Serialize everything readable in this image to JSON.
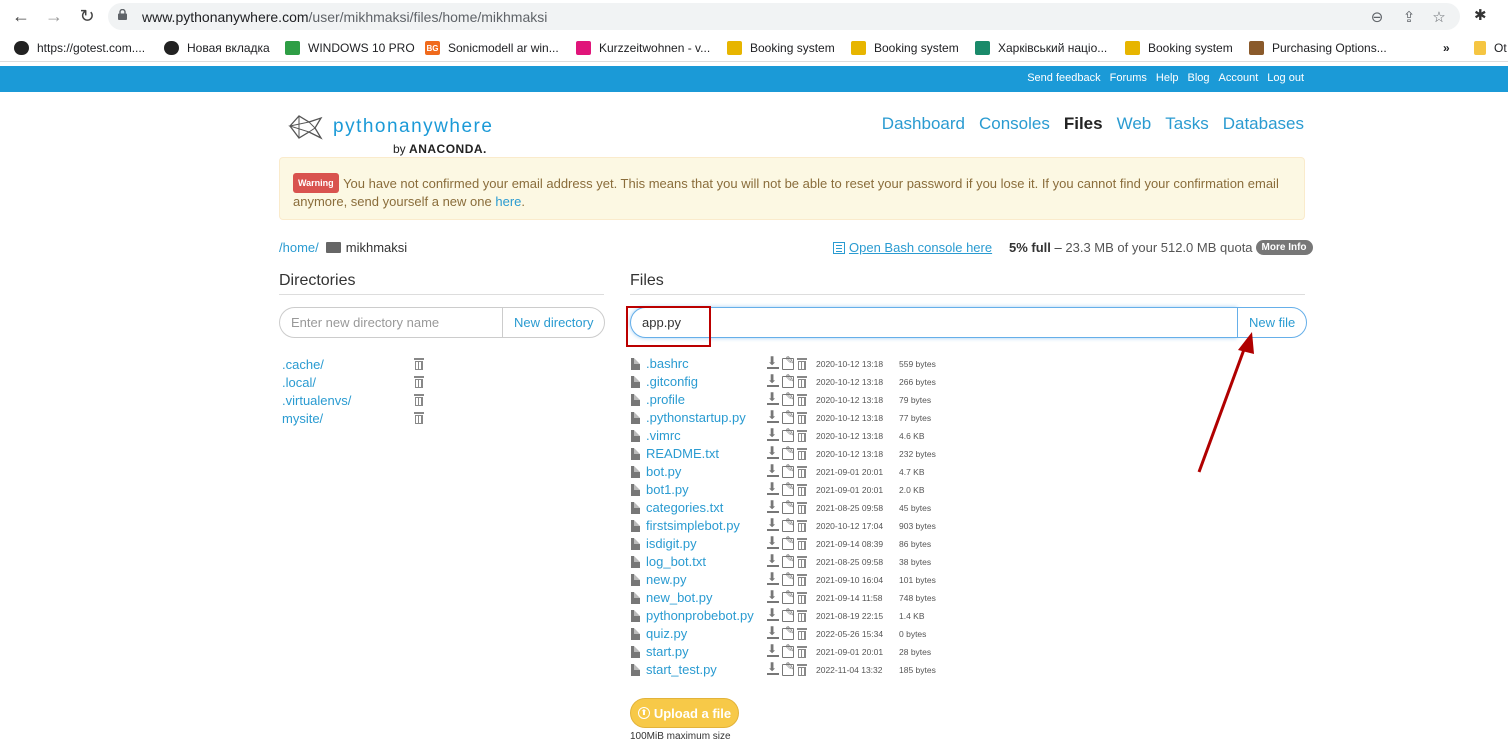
{
  "browser": {
    "url_host": "www.pythonanywhere.com",
    "url_path": "/user/mikhmaksi/files/home/mikhmaksi",
    "bookmarks": [
      {
        "label": "https://gotest.com....",
        "color": "#222222",
        "icon": "globe-icon"
      },
      {
        "label": "Новая вкладка",
        "color": "#222222",
        "icon": "globe-icon"
      },
      {
        "label": "WINDOWS 10 PRO",
        "color": "#2e9e45",
        "icon": "window-icon"
      },
      {
        "label": "Sonicmodell ar win...",
        "color": "#f06a1c",
        "icon": "bg-icon"
      },
      {
        "label": "Kurzzeitwohnen - v...",
        "color": "#e0157a",
        "icon": "magenta-icon"
      },
      {
        "label": "Booking system",
        "color": "#e7b500",
        "icon": "key-icon"
      },
      {
        "label": "Booking system",
        "color": "#e7b500",
        "icon": "key-icon"
      },
      {
        "label": "Харківський націо...",
        "color": "#1a8a6a",
        "icon": "leaf-icon"
      },
      {
        "label": "Booking system",
        "color": "#e7b500",
        "icon": "key-icon"
      },
      {
        "label": "Purchasing Options...",
        "color": "#8a5a2b",
        "icon": "box-icon"
      }
    ],
    "bookmarks_overflow": "»",
    "other_bookmarks": "Ot"
  },
  "topbar": {
    "links": [
      "Send feedback",
      "Forums",
      "Help",
      "Blog",
      "Account",
      "Log out"
    ]
  },
  "logo": {
    "brand_light": "python",
    "brand_bold": "anywhere",
    "by": "by",
    "company": "ANACONDA."
  },
  "nav": {
    "items": [
      "Dashboard",
      "Consoles",
      "Files",
      "Web",
      "Tasks",
      "Databases"
    ],
    "active": "Files"
  },
  "alert": {
    "badge": "Warning",
    "text": "You have not confirmed your email address yet. This means that you will not be able to reset your password if you lose it. If you cannot find your confirmation email anymore, send yourself a new one",
    "link": "here",
    "end": "."
  },
  "breadcrumb": {
    "home": "/home/",
    "current": "mikhmaksi"
  },
  "bash_link": "Open Bash console here",
  "quota": {
    "percent": "5% full",
    "dash": " – ",
    "detail": "23.3 MB of your 512.0 MB quota",
    "more": "More Info"
  },
  "directories": {
    "title": "Directories",
    "placeholder": "Enter new directory name",
    "button": "New directory",
    "items": [
      ".cache/",
      ".local/",
      ".virtualenvs/",
      "mysite/"
    ]
  },
  "files": {
    "title": "Files",
    "input_value": "app.py",
    "button": "New file",
    "items": [
      {
        "name": ".bashrc",
        "date": "2020-10-12 13:18",
        "size": "559 bytes"
      },
      {
        "name": ".gitconfig",
        "date": "2020-10-12 13:18",
        "size": "266 bytes"
      },
      {
        "name": ".profile",
        "date": "2020-10-12 13:18",
        "size": "79 bytes"
      },
      {
        "name": ".pythonstartup.py",
        "date": "2020-10-12 13:18",
        "size": "77 bytes"
      },
      {
        "name": ".vimrc",
        "date": "2020-10-12 13:18",
        "size": "4.6 KB"
      },
      {
        "name": "README.txt",
        "date": "2020-10-12 13:18",
        "size": "232 bytes"
      },
      {
        "name": "bot.py",
        "date": "2021-09-01 20:01",
        "size": "4.7 KB"
      },
      {
        "name": "bot1.py",
        "date": "2021-09-01 20:01",
        "size": "2.0 KB"
      },
      {
        "name": "categories.txt",
        "date": "2021-08-25 09:58",
        "size": "45 bytes"
      },
      {
        "name": "firstsimplebot.py",
        "date": "2020-10-12 17:04",
        "size": "903 bytes"
      },
      {
        "name": "isdigit.py",
        "date": "2021-09-14 08:39",
        "size": "86 bytes"
      },
      {
        "name": "log_bot.txt",
        "date": "2021-08-25 09:58",
        "size": "38 bytes"
      },
      {
        "name": "new.py",
        "date": "2021-09-10 16:04",
        "size": "101 bytes"
      },
      {
        "name": "new_bot.py",
        "date": "2021-09-14 11:58",
        "size": "748 bytes"
      },
      {
        "name": "pythonprobebot.py",
        "date": "2021-08-19 22:15",
        "size": "1.4 KB"
      },
      {
        "name": "quiz.py",
        "date": "2022-05-26 15:34",
        "size": "0 bytes"
      },
      {
        "name": "start.py",
        "date": "2021-09-01 20:01",
        "size": "28 bytes"
      },
      {
        "name": "start_test.py",
        "date": "2022-11-04 13:32",
        "size": "185 bytes"
      }
    ],
    "upload_button": "Upload a file",
    "upload_note": "100MiB maximum size"
  },
  "colors": {
    "accent": "#1b9ad7",
    "link": "#2a9bd1",
    "annotation": "#b00000",
    "upload": "#f7c948"
  }
}
